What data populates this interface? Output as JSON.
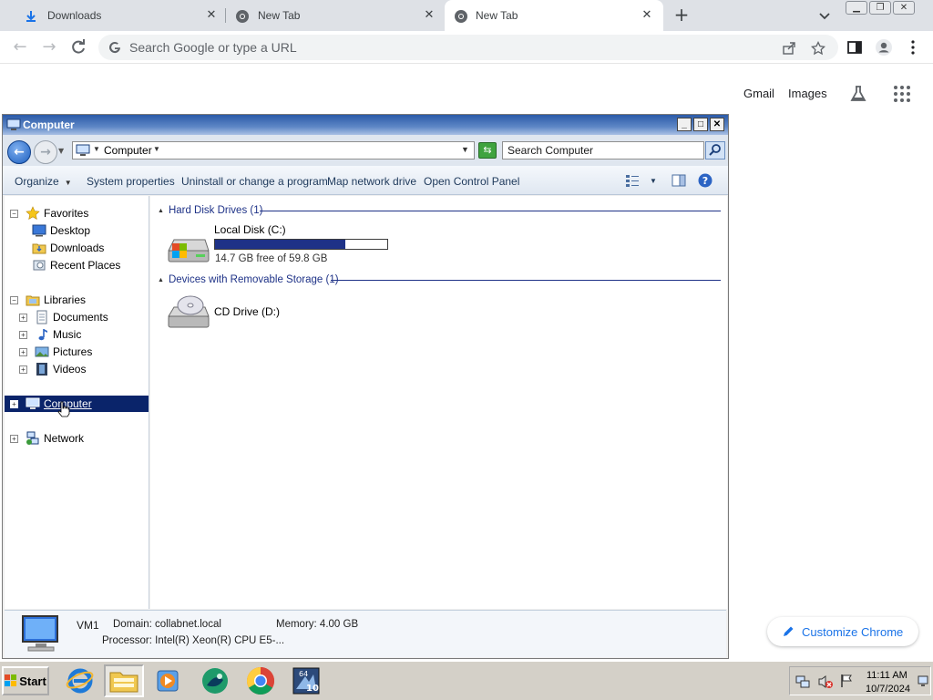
{
  "chrome": {
    "tabs": [
      {
        "title": "Downloads",
        "active": false
      },
      {
        "title": "New Tab",
        "active": false
      },
      {
        "title": "New Tab",
        "active": true
      }
    ],
    "omnibox_placeholder": "Search Google or type a URL",
    "ntp_links": {
      "gmail": "Gmail",
      "images": "Images"
    },
    "customize_label": "Customize Chrome"
  },
  "explorer": {
    "window_title": "Computer",
    "address": "Computer",
    "search_placeholder": "Search Computer",
    "commands": [
      "Organize",
      "System properties",
      "Uninstall or change a program",
      "Map network drive",
      "Open Control Panel"
    ],
    "nav": {
      "favorites": "Favorites",
      "desktop": "Desktop",
      "downloads": "Downloads",
      "recent_places": "Recent Places",
      "libraries": "Libraries",
      "documents": "Documents",
      "music": "Music",
      "pictures": "Pictures",
      "videos": "Videos",
      "computer": "Computer",
      "network": "Network"
    },
    "groups": {
      "hard_disks": "Hard Disk Drives (1)",
      "removable": "Devices with Removable Storage (1)"
    },
    "drives": {
      "local": {
        "name": "Local Disk (C:)",
        "free": "14.7 GB free of 59.8 GB",
        "used_fraction": 0.754
      },
      "cd": {
        "name": "CD Drive (D:)"
      }
    },
    "details": {
      "name": "VM1",
      "domain": "Domain: collabnet.local",
      "memory": "Memory: 4.00 GB",
      "processor": "Processor: Intel(R) Xeon(R) CPU E5-..."
    }
  },
  "taskbar": {
    "start_label": "Start",
    "time": "11:11 AM",
    "date": "10/7/2024"
  },
  "colors": {
    "selection": "#0a246a",
    "chrome_link": "#1a73e8",
    "title_bar": "#2a5aa8"
  }
}
